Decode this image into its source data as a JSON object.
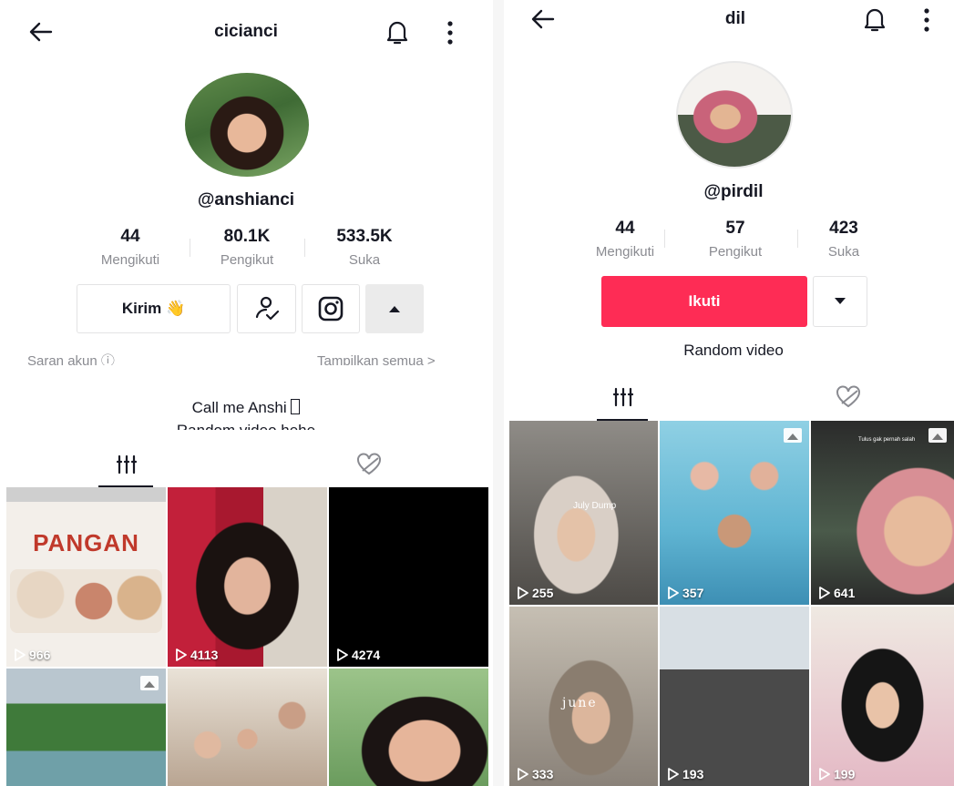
{
  "left": {
    "username": "cicianci",
    "handle": "@anshianci",
    "stats": [
      {
        "value": "44",
        "label": "Mengikuti"
      },
      {
        "value": "80.1K",
        "label": "Pengikut"
      },
      {
        "value": "533.5K",
        "label": "Suka"
      }
    ],
    "message_button": "Kirim 👋",
    "suggested_label": "Saran akun",
    "show_all_label": "Tampilkan semua >",
    "bio_line1": "Call me Anshi ",
    "bio_line2": "Random video hehe",
    "videos": [
      {
        "views": "966",
        "overlay_text": "PANGAN"
      },
      {
        "views": "4113"
      },
      {
        "views": "4274"
      },
      {
        "views": ""
      },
      {
        "views": ""
      },
      {
        "views": ""
      }
    ]
  },
  "right": {
    "username": "dil",
    "handle": "@pirdil",
    "stats": [
      {
        "value": "44",
        "label": "Mengikuti"
      },
      {
        "value": "57",
        "label": "Pengikut"
      },
      {
        "value": "423",
        "label": "Suka"
      }
    ],
    "follow_button": "Ikuti",
    "bio": "Random video",
    "videos": [
      {
        "views": "255",
        "overlay_text": "July Dump"
      },
      {
        "views": "357"
      },
      {
        "views": "641",
        "overlay_text": "Tulus gak pernah salah"
      },
      {
        "views": "333",
        "overlay_text": "june"
      },
      {
        "views": "193"
      },
      {
        "views": "199"
      }
    ]
  },
  "colors": {
    "accent": "#fe2c55",
    "text": "#161823",
    "muted": "#8a8b91"
  }
}
